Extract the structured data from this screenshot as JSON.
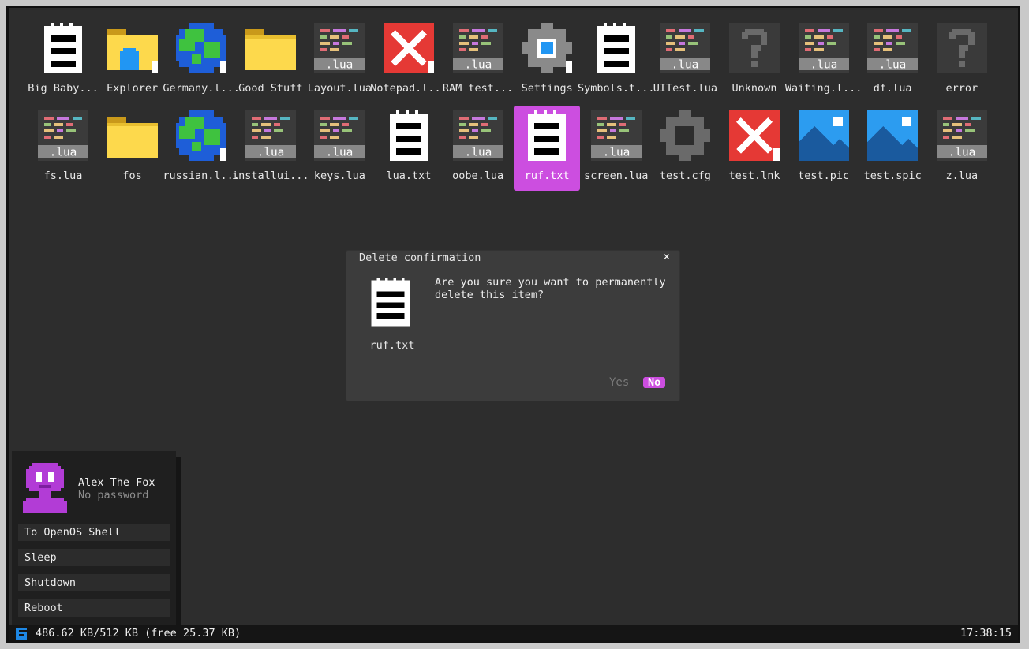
{
  "desktop": {
    "row1": [
      {
        "label": "Big Baby...",
        "icon": "text-file-icon"
      },
      {
        "label": "Explorer",
        "icon": "folder-app-icon"
      },
      {
        "label": "Germany.l...",
        "icon": "globe-icon"
      },
      {
        "label": "Good Stuff",
        "icon": "folder-icon"
      },
      {
        "label": "Layout.lua",
        "icon": "lua-file-icon"
      },
      {
        "label": "Notepad.l...",
        "icon": "error-x-icon"
      },
      {
        "label": "RAM test...",
        "icon": "lua-file-icon"
      },
      {
        "label": "Settings",
        "icon": "settings-gear-icon"
      },
      {
        "label": "Symbols.t...",
        "icon": "text-file-icon"
      },
      {
        "label": "UITest.lua",
        "icon": "lua-file-icon"
      },
      {
        "label": "Unknown",
        "icon": "unknown-question-icon"
      },
      {
        "label": "Waiting.l...",
        "icon": "lua-file-icon"
      },
      {
        "label": "df.lua",
        "icon": "lua-file-icon"
      },
      {
        "label": "error",
        "icon": "unknown-question-icon"
      }
    ],
    "row2": [
      {
        "label": "fs.lua",
        "icon": "lua-file-icon"
      },
      {
        "label": "fos",
        "icon": "folder-icon"
      },
      {
        "label": "russian.l...",
        "icon": "globe-icon"
      },
      {
        "label": "installui...",
        "icon": "lua-file-icon"
      },
      {
        "label": "keys.lua",
        "icon": "lua-file-icon"
      },
      {
        "label": "lua.txt",
        "icon": "text-file-icon"
      },
      {
        "label": "oobe.lua",
        "icon": "lua-file-icon"
      },
      {
        "label": "ruf.txt",
        "icon": "text-file-icon"
      },
      {
        "label": "screen.lua",
        "icon": "lua-file-icon"
      },
      {
        "label": "test.cfg",
        "icon": "config-gear-icon"
      },
      {
        "label": "test.lnk",
        "icon": "error-x-icon"
      },
      {
        "label": "test.pic",
        "icon": "picture-icon"
      },
      {
        "label": "test.spic",
        "icon": "picture-icon"
      },
      {
        "label": "z.lua",
        "icon": "lua-file-icon"
      }
    ],
    "lua_badge": ".lua"
  },
  "dialog": {
    "title": "Delete confirmation",
    "close": "×",
    "file_name": "ruf.txt",
    "message": "Are you sure you want to permanently delete this item?",
    "yes_label": "Yes",
    "no_label": "No"
  },
  "menu": {
    "user_name": "Alex The Fox",
    "user_password": "No password",
    "items": [
      "To OpenOS Shell",
      "Sleep",
      "Shutdown",
      "Reboot"
    ]
  },
  "status": {
    "memory": "486.62 KB/512 KB (free 25.37 KB)",
    "time": "17:38:15"
  },
  "colors": {
    "accent": "#cc4ee0",
    "desktop_bg": "#2d2d2d",
    "status_bg": "#151515",
    "dialog_bg": "#3c3c3c"
  }
}
